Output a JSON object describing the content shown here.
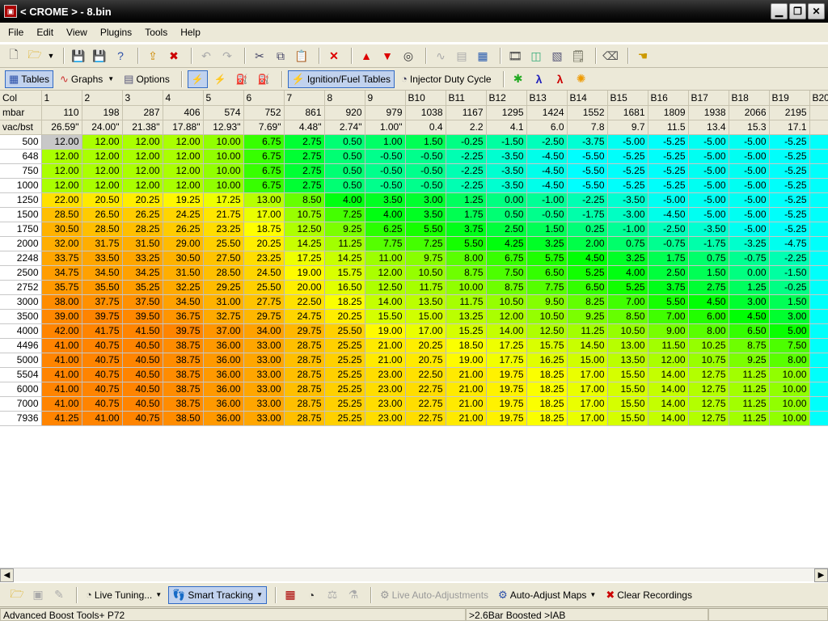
{
  "window": {
    "title": "< CROME > - 8.bin",
    "app_icon": "app-icon",
    "min": "▁",
    "max": "❐",
    "close": "✕"
  },
  "menu": [
    "File",
    "Edit",
    "View",
    "Plugins",
    "Tools",
    "Help"
  ],
  "toolbar2": {
    "tables": "Tables",
    "graphs": "Graphs",
    "options": "Options",
    "ign_fuel": "Ignition/Fuel Tables",
    "injector": "Injector Duty Cycle"
  },
  "grid": {
    "header_cols": [
      "Col",
      "1",
      "2",
      "3",
      "4",
      "5",
      "6",
      "7",
      "8",
      "9",
      "B10",
      "B11",
      "B12",
      "B13",
      "B14",
      "B15",
      "B16",
      "B17",
      "B18",
      "B19",
      "B20"
    ],
    "mbar_label": "mbar",
    "mbar": [
      "110",
      "198",
      "287",
      "406",
      "574",
      "752",
      "861",
      "920",
      "979",
      "1038",
      "1167",
      "1295",
      "1424",
      "1552",
      "1681",
      "1809",
      "1938",
      "2066",
      "2195",
      "2"
    ],
    "vac_label": "vac/bst",
    "vac": [
      "26.59\"",
      "24.00\"",
      "21.38\"",
      "17.88\"",
      "12.93\"",
      "7.69\"",
      "4.48\"",
      "2.74\"",
      "1.00\"",
      "0.4",
      "2.2",
      "4.1",
      "6.0",
      "7.8",
      "9.7",
      "11.5",
      "13.4",
      "15.3",
      "17.1",
      "2"
    ],
    "rows": [
      {
        "rpm": "500",
        "vals": [
          "12.00",
          "12.00",
          "12.00",
          "12.00",
          "10.00",
          "6.75",
          "2.75",
          "0.50",
          "1.00",
          "1.50",
          "-0.25",
          "-1.50",
          "-2.50",
          "-3.75",
          "-5.00",
          "-5.25",
          "-5.00",
          "-5.00",
          "-5.25",
          "-"
        ]
      },
      {
        "rpm": "648",
        "vals": [
          "12.00",
          "12.00",
          "12.00",
          "12.00",
          "10.00",
          "6.75",
          "2.75",
          "0.50",
          "-0.50",
          "-0.50",
          "-2.25",
          "-3.50",
          "-4.50",
          "-5.50",
          "-5.25",
          "-5.25",
          "-5.00",
          "-5.00",
          "-5.25",
          "-"
        ]
      },
      {
        "rpm": "750",
        "vals": [
          "12.00",
          "12.00",
          "12.00",
          "12.00",
          "10.00",
          "6.75",
          "2.75",
          "0.50",
          "-0.50",
          "-0.50",
          "-2.25",
          "-3.50",
          "-4.50",
          "-5.50",
          "-5.25",
          "-5.25",
          "-5.00",
          "-5.00",
          "-5.25",
          "-"
        ]
      },
      {
        "rpm": "1000",
        "vals": [
          "12.00",
          "12.00",
          "12.00",
          "12.00",
          "10.00",
          "6.75",
          "2.75",
          "0.50",
          "-0.50",
          "-0.50",
          "-2.25",
          "-3.50",
          "-4.50",
          "-5.50",
          "-5.25",
          "-5.25",
          "-5.00",
          "-5.00",
          "-5.25",
          "-"
        ]
      },
      {
        "rpm": "1250",
        "vals": [
          "22.00",
          "20.50",
          "20.25",
          "19.25",
          "17.25",
          "13.00",
          "8.50",
          "4.00",
          "3.50",
          "3.00",
          "1.25",
          "0.00",
          "-1.00",
          "-2.25",
          "-3.50",
          "-5.00",
          "-5.00",
          "-5.00",
          "-5.25",
          "-"
        ]
      },
      {
        "rpm": "1500",
        "vals": [
          "28.50",
          "26.50",
          "26.25",
          "24.25",
          "21.75",
          "17.00",
          "10.75",
          "7.25",
          "4.00",
          "3.50",
          "1.75",
          "0.50",
          "-0.50",
          "-1.75",
          "-3.00",
          "-4.50",
          "-5.00",
          "-5.00",
          "-5.25",
          "-"
        ]
      },
      {
        "rpm": "1750",
        "vals": [
          "30.50",
          "28.50",
          "28.25",
          "26.25",
          "23.25",
          "18.75",
          "12.50",
          "9.25",
          "6.25",
          "5.50",
          "3.75",
          "2.50",
          "1.50",
          "0.25",
          "-1.00",
          "-2.50",
          "-3.50",
          "-5.00",
          "-5.25",
          "-"
        ]
      },
      {
        "rpm": "2000",
        "vals": [
          "32.00",
          "31.75",
          "31.50",
          "29.00",
          "25.50",
          "20.25",
          "14.25",
          "11.25",
          "7.75",
          "7.25",
          "5.50",
          "4.25",
          "3.25",
          "2.00",
          "0.75",
          "-0.75",
          "-1.75",
          "-3.25",
          "-4.75",
          "-"
        ]
      },
      {
        "rpm": "2248",
        "vals": [
          "33.75",
          "33.50",
          "33.25",
          "30.50",
          "27.50",
          "23.25",
          "17.25",
          "14.25",
          "11.00",
          "9.75",
          "8.00",
          "6.75",
          "5.75",
          "4.50",
          "3.25",
          "1.75",
          "0.75",
          "-0.75",
          "-2.25",
          "-"
        ]
      },
      {
        "rpm": "2500",
        "vals": [
          "34.75",
          "34.50",
          "34.25",
          "31.50",
          "28.50",
          "24.50",
          "19.00",
          "15.75",
          "12.00",
          "10.50",
          "8.75",
          "7.50",
          "6.50",
          "5.25",
          "4.00",
          "2.50",
          "1.50",
          "0.00",
          "-1.50",
          "-"
        ]
      },
      {
        "rpm": "2752",
        "vals": [
          "35.75",
          "35.50",
          "35.25",
          "32.25",
          "29.25",
          "25.50",
          "20.00",
          "16.50",
          "12.50",
          "11.75",
          "10.00",
          "8.75",
          "7.75",
          "6.50",
          "5.25",
          "3.75",
          "2.75",
          "1.25",
          "-0.25",
          "-"
        ]
      },
      {
        "rpm": "3000",
        "vals": [
          "38.00",
          "37.75",
          "37.50",
          "34.50",
          "31.00",
          "27.75",
          "22.50",
          "18.25",
          "14.00",
          "13.50",
          "11.75",
          "10.50",
          "9.50",
          "8.25",
          "7.00",
          "5.50",
          "4.50",
          "3.00",
          "1.50",
          "-"
        ]
      },
      {
        "rpm": "3500",
        "vals": [
          "39.00",
          "39.75",
          "39.50",
          "36.75",
          "32.75",
          "29.75",
          "24.75",
          "20.25",
          "15.50",
          "15.00",
          "13.25",
          "12.00",
          "10.50",
          "9.25",
          "8.50",
          "7.00",
          "6.00",
          "4.50",
          "3.00",
          "-"
        ]
      },
      {
        "rpm": "4000",
        "vals": [
          "42.00",
          "41.75",
          "41.50",
          "39.75",
          "37.00",
          "34.00",
          "29.75",
          "25.50",
          "19.00",
          "17.00",
          "15.25",
          "14.00",
          "12.50",
          "11.25",
          "10.50",
          "9.00",
          "8.00",
          "6.50",
          "5.00",
          "-"
        ]
      },
      {
        "rpm": "4496",
        "vals": [
          "41.00",
          "40.75",
          "40.50",
          "38.75",
          "36.00",
          "33.00",
          "28.75",
          "25.25",
          "21.00",
          "20.25",
          "18.50",
          "17.25",
          "15.75",
          "14.50",
          "13.00",
          "11.50",
          "10.25",
          "8.75",
          "7.50",
          "-"
        ]
      },
      {
        "rpm": "5000",
        "vals": [
          "41.00",
          "40.75",
          "40.50",
          "38.75",
          "36.00",
          "33.00",
          "28.75",
          "25.25",
          "21.00",
          "20.75",
          "19.00",
          "17.75",
          "16.25",
          "15.00",
          "13.50",
          "12.00",
          "10.75",
          "9.25",
          "8.00",
          "-"
        ]
      },
      {
        "rpm": "5504",
        "vals": [
          "41.00",
          "40.75",
          "40.50",
          "38.75",
          "36.00",
          "33.00",
          "28.75",
          "25.25",
          "23.00",
          "22.50",
          "21.00",
          "19.75",
          "18.25",
          "17.00",
          "15.50",
          "14.00",
          "12.75",
          "11.25",
          "10.00",
          "-"
        ]
      },
      {
        "rpm": "6000",
        "vals": [
          "41.00",
          "40.75",
          "40.50",
          "38.75",
          "36.00",
          "33.00",
          "28.75",
          "25.25",
          "23.00",
          "22.75",
          "21.00",
          "19.75",
          "18.25",
          "17.00",
          "15.50",
          "14.00",
          "12.75",
          "11.25",
          "10.00",
          "-"
        ]
      },
      {
        "rpm": "7000",
        "vals": [
          "41.00",
          "40.75",
          "40.50",
          "38.75",
          "36.00",
          "33.00",
          "28.75",
          "25.25",
          "23.00",
          "22.75",
          "21.00",
          "19.75",
          "18.25",
          "17.00",
          "15.50",
          "14.00",
          "12.75",
          "11.25",
          "10.00",
          "-"
        ]
      },
      {
        "rpm": "7936",
        "vals": [
          "41.25",
          "41.00",
          "40.75",
          "38.50",
          "36.00",
          "33.00",
          "28.75",
          "25.25",
          "23.00",
          "22.75",
          "21.00",
          "19.75",
          "18.25",
          "17.00",
          "15.50",
          "14.00",
          "12.75",
          "11.25",
          "10.00",
          "-"
        ]
      }
    ]
  },
  "bottom_toolbar": {
    "live_tuning": "Live Tuning...",
    "smart_tracking": "Smart Tracking",
    "live_auto": "Live Auto-Adjustments",
    "auto_adjust": "Auto-Adjust Maps",
    "clear_rec": "Clear Recordings"
  },
  "status": {
    "left": "Advanced Boost Tools+ P72",
    "mid": ">2.6Bar Boosted >IAB"
  }
}
